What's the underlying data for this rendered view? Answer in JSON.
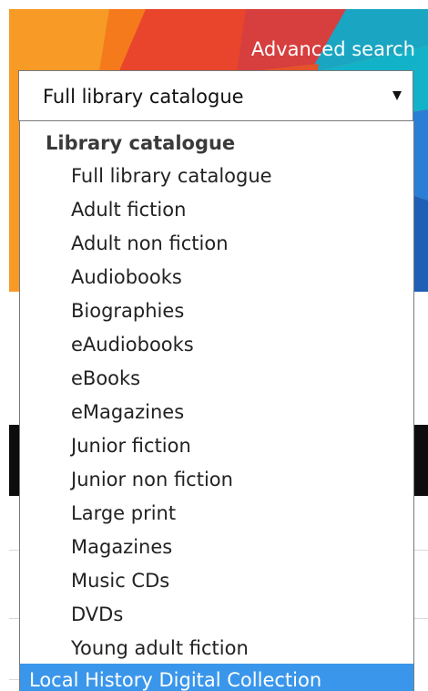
{
  "header": {
    "advanced_search": "Advanced search"
  },
  "select": {
    "value": "Full library catalogue"
  },
  "dropdown": {
    "group_label": "Library catalogue",
    "options": [
      "Full library catalogue",
      "Adult fiction",
      "Adult non fiction",
      "Audiobooks",
      "Biographies",
      "eAudiobooks",
      "eBooks",
      "eMagazines",
      "Junior fiction",
      "Junior non fiction",
      "Large print",
      "Magazines",
      "Music CDs",
      "DVDs",
      "Young adult fiction"
    ],
    "highlighted": "Local History Digital Collection"
  },
  "colors": {
    "highlight": "#3a96eb",
    "banner_orange": "#f47a1c",
    "banner_red": "#e8452c",
    "banner_teal": "#12b3c9",
    "banner_blue": "#2a7ed6"
  }
}
